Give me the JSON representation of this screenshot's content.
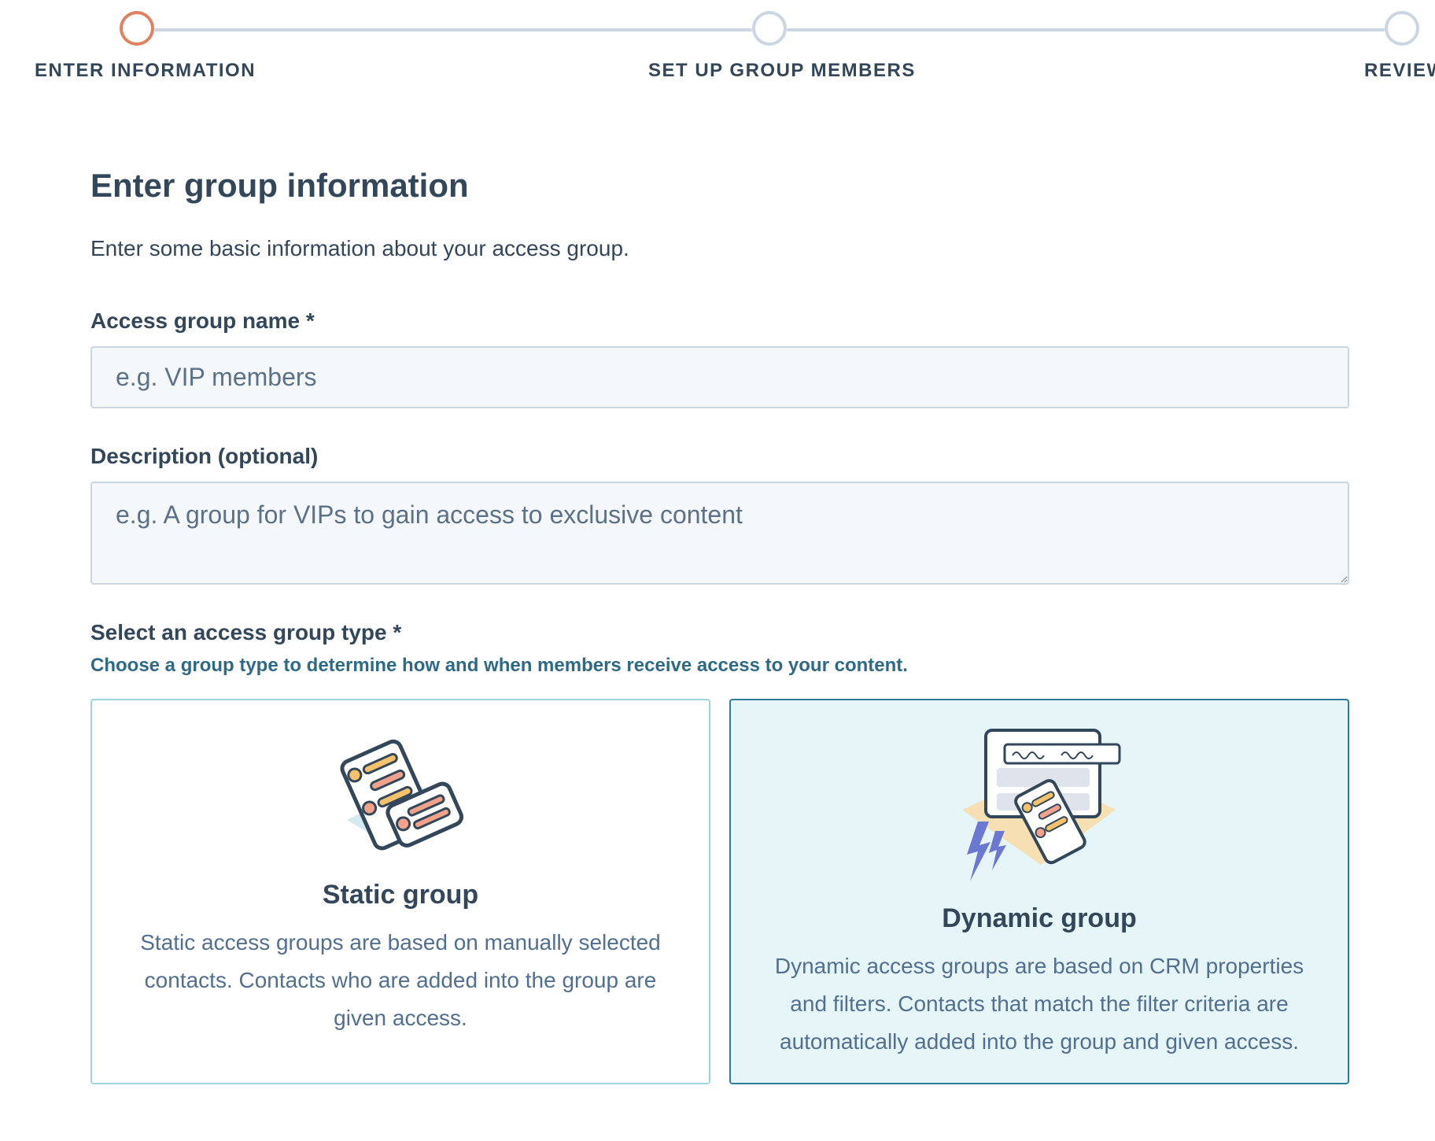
{
  "stepper": {
    "steps": [
      {
        "label": "ENTER INFORMATION",
        "state": "active"
      },
      {
        "label": "SET UP GROUP MEMBERS",
        "state": "upcoming"
      },
      {
        "label": "REVIEW",
        "state": "upcoming"
      }
    ]
  },
  "form": {
    "title": "Enter group information",
    "intro": "Enter some basic information about your access group.",
    "name_field": {
      "label": "Access group name *",
      "value": "",
      "placeholder": "e.g. VIP members"
    },
    "description_field": {
      "label": "Description (optional)",
      "value": "",
      "placeholder": "e.g. A group for VIPs to gain access to exclusive content"
    },
    "type_field": {
      "label": "Select an access group type *",
      "help": "Choose a group type to determine how and when members receive access to your content.",
      "options": [
        {
          "title": "Static group",
          "description": "Static access groups are based on manually selected contacts. Contacts who are added into the group are given access.",
          "selected": false,
          "icon": "static-group-illustration"
        },
        {
          "title": "Dynamic group",
          "description": "Dynamic access groups are based on CRM properties and filters. Contacts that match the filter criteria are automatically added into the group and given access.",
          "selected": true,
          "icon": "dynamic-group-illustration"
        }
      ]
    }
  },
  "colors": {
    "active_step": "#e0815f",
    "inactive_step": "#cbd6e2",
    "text": "#33475b",
    "help_text": "#2e6a86",
    "selected_card_bg": "#e5f5f8",
    "selected_card_border": "#2e7d98",
    "card_border": "#9fd3dc"
  }
}
